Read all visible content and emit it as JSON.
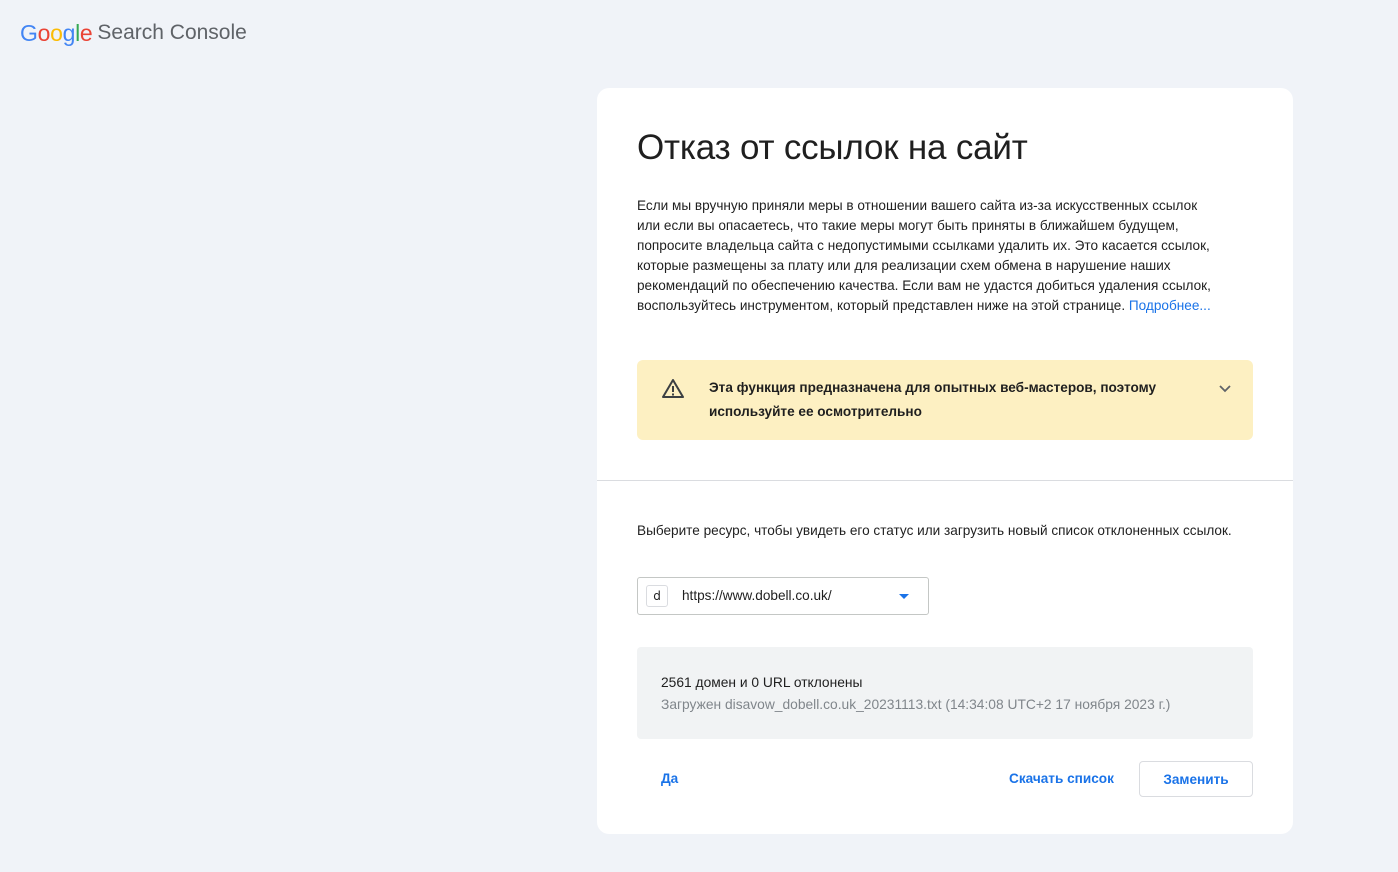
{
  "header": {
    "logo_letters": [
      "G",
      "o",
      "o",
      "g",
      "l",
      "e"
    ],
    "logo_colors": [
      "#4285f4",
      "#ea4335",
      "#fbbc05",
      "#4285f4",
      "#34a853",
      "#ea4335"
    ],
    "product_name": "Search Console"
  },
  "card": {
    "title": "Отказ от ссылок на сайт",
    "intro_text": "Если мы вручную приняли меры в отношении вашего сайта из-за искусственных ссылок или если вы опасаетесь, что такие меры могут быть приняты в ближайшем будущем, попросите владельца сайта с недопустимыми ссылками удалить их. Это касается ссылок, которые размещены за плату или для реализации схем обмена в нарушение наших рекомендаций по обеспечению качества. Если вам не удастся добиться удаления ссылок, воспользуйтесь инструментом, который представлен ниже на этой странице.",
    "learn_more_link": "Подробнее...",
    "warning": {
      "icon": "warning-triangle-icon",
      "text": "Эта функция предназначена для опытных веб-мастеров, поэтому используйте ее осмотрительно",
      "background_color": "#fdf0c2",
      "expand_icon": "chevron-down-icon"
    },
    "select_label": "Выберите ресурс, чтобы увидеть его статус или загрузить новый список отклоненных ссылок.",
    "resource": {
      "favicon_letter": "d",
      "url": "https://www.dobell.co.uk/"
    },
    "status": {
      "main": "2561 домен и 0 URL отклонены",
      "sub": "Загружен disavow_dobell.co.uk_20231113.txt (14:34:08 UTC+2 17 ноября 2023 г.)"
    },
    "actions": {
      "yes_label": "Да",
      "download_label": "Скачать список",
      "replace_label": "Заменить"
    }
  },
  "colors": {
    "accent": "#1a73e8",
    "page_background": "#f0f3f8"
  }
}
